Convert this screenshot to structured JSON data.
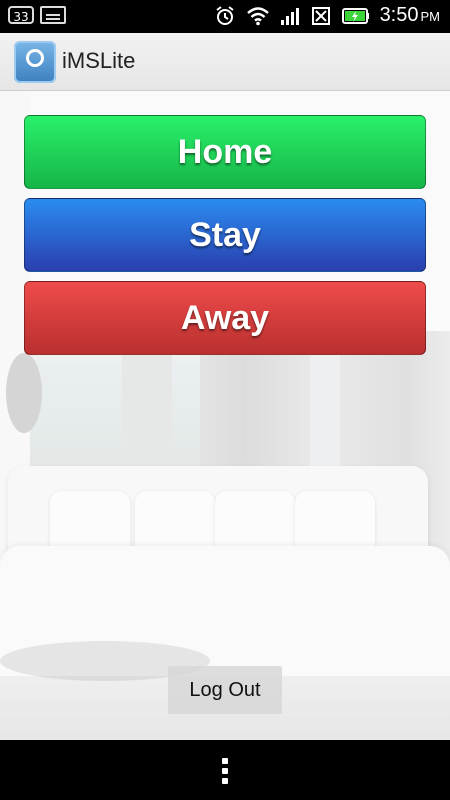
{
  "status_bar": {
    "badge_text": "33",
    "icons": [
      "notification-33-icon",
      "image-icon",
      "alarm-icon",
      "wifi-icon",
      "signal-icon",
      "no-sim-icon",
      "battery-charging-icon"
    ],
    "time": "3:50",
    "ampm": "PM"
  },
  "action_bar": {
    "app_title": "iMSLite",
    "app_icon": "app-logo-icon"
  },
  "modes": {
    "home_label": "Home",
    "stay_label": "Stay",
    "away_label": "Away",
    "colors": {
      "home": "#1fd35a",
      "stay": "#2a62d0",
      "away": "#d93b3b"
    }
  },
  "logout_label": "Log Out",
  "nav_bar": {
    "menu_icon": "overflow-menu-icon"
  }
}
